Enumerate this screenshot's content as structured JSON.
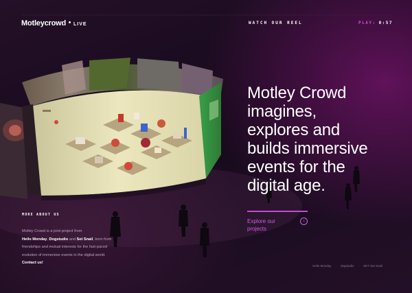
{
  "header": {
    "brand_name": "Motleycrowd",
    "brand_live": "LIVE",
    "watch_reel": "WATCH OUR REEL",
    "play_label": "PLAY:",
    "play_time": "0:57"
  },
  "headline": {
    "lines": [
      "Motley Crowd",
      "imagines,",
      "explores and",
      "builds immersive",
      "events for the",
      "digital age."
    ]
  },
  "explore": {
    "line1": "Explore our",
    "line2": "projects",
    "arrow": "›"
  },
  "about": {
    "title": "MORE ABOUT US",
    "text_1": "Motley Crowd is a joint project from",
    "link_hello_monday": "Hello Monday",
    "comma": ",",
    "link_dogstudio": "Dogstudio",
    "and": "and",
    "link_set_snail": "Set Snail",
    "text_2": ", born from friendships and mutual interests for the fast-paced evolution of immersive events in the digital world.",
    "link_contact": "Contact us!"
  },
  "footer": {
    "items": [
      "Hello Monday",
      "dogstudio",
      "SET Set Snail"
    ]
  },
  "colors": {
    "accent": "#c44bd4",
    "play_accent": "#d44fd6"
  }
}
